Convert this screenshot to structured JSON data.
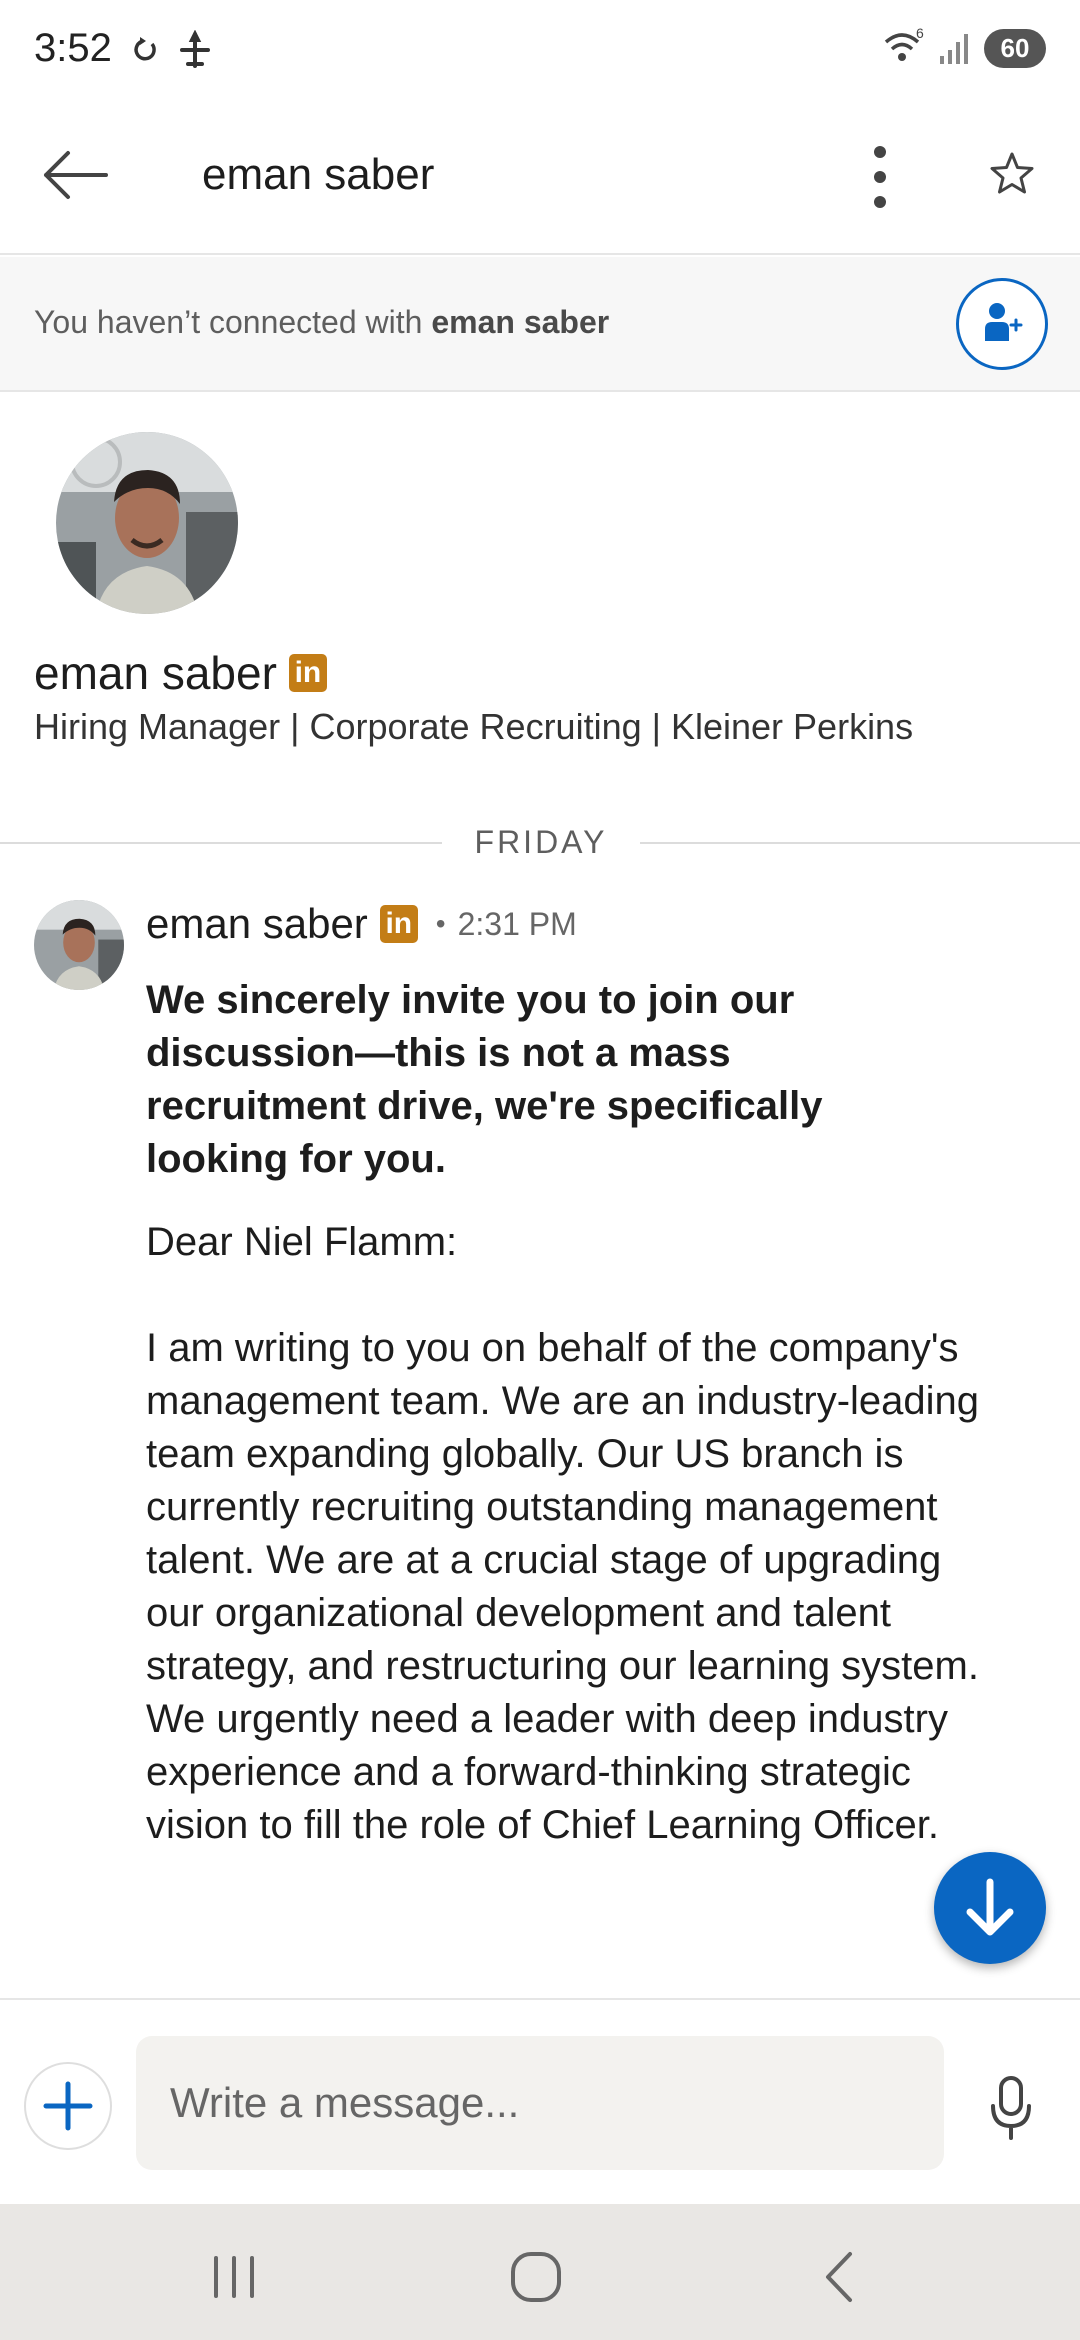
{
  "status_bar": {
    "time": "3:52",
    "wifi_badge": "6",
    "battery": "60",
    "icons": [
      "sync-icon",
      "airplane-icon",
      "wifi-icon",
      "signal-icon",
      "battery-icon"
    ]
  },
  "header": {
    "title": "eman saber"
  },
  "connection_banner": {
    "text_prefix": "You haven’t connected with ",
    "name": "eman saber"
  },
  "profile": {
    "name": "eman saber",
    "badge_text": "in",
    "headline": "Hiring Manager | Corporate Recruiting | Kleiner Perkins"
  },
  "day_divider": "FRIDAY",
  "message": {
    "sender": "eman saber",
    "badge_text": "in",
    "separator": "•",
    "time": "2:31 PM",
    "subject": "We sincerely invite you to join our discussion—this is not a mass recruitment drive, we're specifically looking for you.",
    "body": "Dear Niel Flamm:\n\nI am writing to you on behalf of the company's management team. We are an industry-leading team expanding globally. Our US branch is currently recruiting outstanding management talent. We are at a crucial stage of upgrading our organizational development and talent strategy, and restructuring our learning system. We urgently need a leader with deep industry experience and a forward-thinking strategic vision to fill the role of Chief Learning Officer."
  },
  "composer": {
    "placeholder": "Write a message..."
  },
  "colors": {
    "brand_blue": "#0a66c2",
    "badge_gold": "#c37d16"
  }
}
